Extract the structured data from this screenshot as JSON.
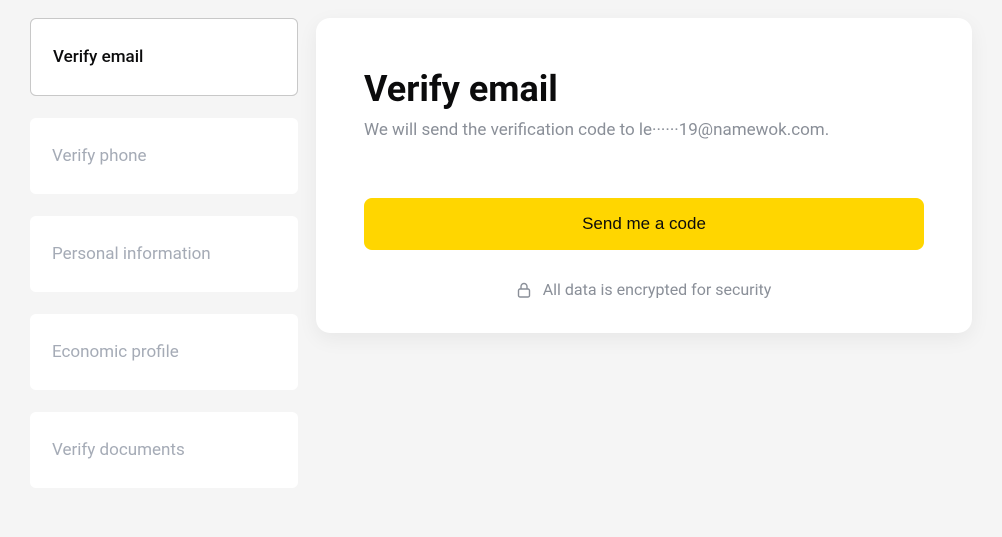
{
  "sidebar": {
    "items": [
      {
        "label": "Verify email",
        "active": true
      },
      {
        "label": "Verify phone",
        "active": false
      },
      {
        "label": "Personal information",
        "active": false
      },
      {
        "label": "Economic profile",
        "active": false
      },
      {
        "label": "Verify documents",
        "active": false
      }
    ]
  },
  "main": {
    "title": "Verify email",
    "subtitle": "We will send the verification code to le······19@namewok.com.",
    "send_button_label": "Send me a code",
    "security_note": "All data is encrypted for security"
  },
  "colors": {
    "accent": "#ffd600",
    "text_muted": "#8a8f98",
    "text_primary": "#0b0b0c",
    "bg_page": "#f5f5f5",
    "bg_card": "#ffffff"
  }
}
